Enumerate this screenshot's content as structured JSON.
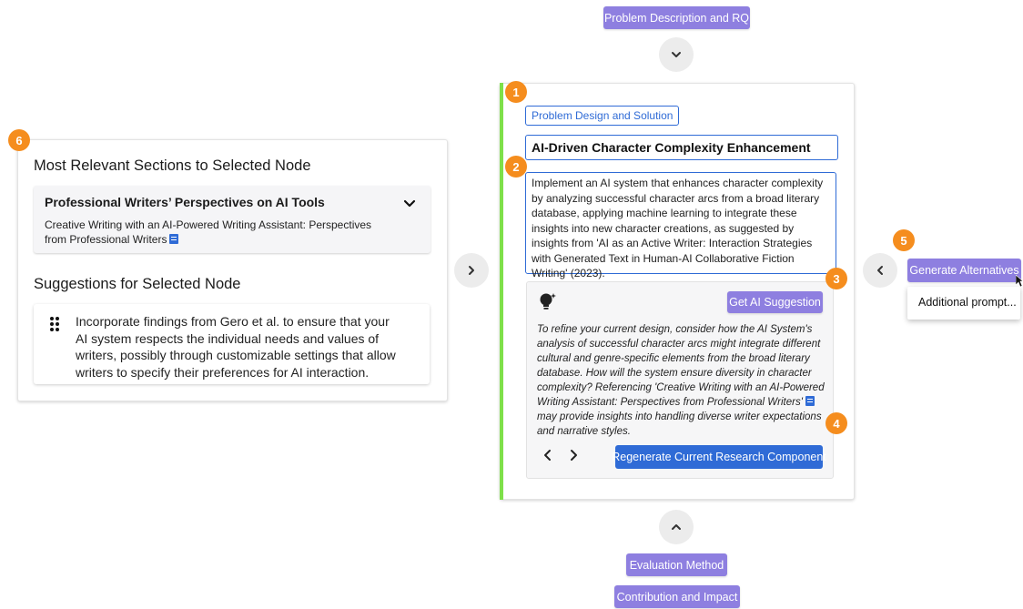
{
  "top_nav": {
    "problem_label": "Problem Description and RQ",
    "evaluation_label": "Evaluation Method",
    "contribution_label": "Contribution and Impact"
  },
  "badges": [
    "1",
    "2",
    "3",
    "4",
    "5",
    "6"
  ],
  "left_panel": {
    "title": "Most Relevant Sections to Selected Node",
    "section": {
      "title": "Professional Writers’ Perspectives on AI Tools",
      "source": "Creative Writing with an AI-Powered Writing Assistant: Perspectives from Professional Writers"
    },
    "suggestions_title": "Suggestions for Selected Node",
    "suggestion_text": "Incorporate findings from Gero et al. to ensure that your AI system respects the individual needs and values of writers, possibly through customizable settings that allow writers to specify their preferences for AI interaction."
  },
  "center_panel": {
    "tag": "Problem Design and Solution",
    "title": "AI-Driven Character Complexity Enhancement",
    "description": "Implement an AI system that enhances character complexity by analyzing successful character arcs from a broad literary database, applying machine learning to integrate these insights into new character creations, as suggested by insights from 'AI as an Active Writer: Interaction Strategies with Generated Text in Human-AI Collaborative Fiction Writing' (2023).",
    "ai_box": {
      "get_button": "Get AI Suggestion",
      "suggestion_part1": "To refine your current design, consider how the AI System's analysis of successful character arcs might integrate different cultural and genre-specific elements from the broad literary database. How will the system ensure diversity in character complexity? Referencing 'Creative Writing with an AI-Powered Writing Assistant: Perspectives from Professional Writers'",
      "suggestion_part2": "may provide insights into handling diverse writer expectations and narrative styles.",
      "regenerate_button": "Regenerate Current Research Component"
    }
  },
  "right_panel": {
    "generate_button": "Generate Alternatives",
    "dropdown_item": "Additional prompt..."
  },
  "colors": {
    "purple": "#8e7fe0",
    "blue": "#2f6bd6",
    "orange": "#f58d1e",
    "green_bar": "#7ee04a"
  },
  "icons": [
    "chevron-down-icon",
    "chevron-up-icon",
    "chevron-right-icon",
    "chevron-left-icon",
    "lightbulb-sparkle-icon",
    "drag-handle-icon",
    "document-icon",
    "cursor-icon"
  ]
}
